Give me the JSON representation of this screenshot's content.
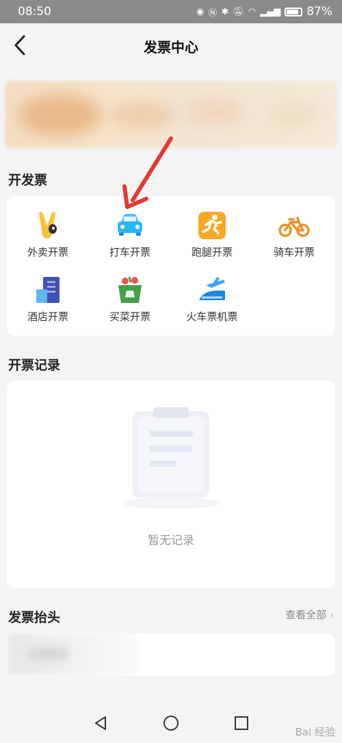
{
  "status_bar": {
    "time": "08:50",
    "battery_pct": "87%"
  },
  "header": {
    "title": "发票中心"
  },
  "invoice_section": {
    "title": "开发票",
    "services": [
      {
        "label": "外卖开票",
        "icon": "waimai-icon"
      },
      {
        "label": "打车开票",
        "icon": "taxi-icon"
      },
      {
        "label": "跑腿开票",
        "icon": "errand-icon"
      },
      {
        "label": "骑车开票",
        "icon": "bike-icon"
      },
      {
        "label": "酒店开票",
        "icon": "hotel-icon"
      },
      {
        "label": "买菜开票",
        "icon": "grocery-icon"
      },
      {
        "label": "火车票机票",
        "icon": "train-plane-icon"
      }
    ]
  },
  "records_section": {
    "title": "开票记录",
    "empty_text": "暂无记录"
  },
  "header_section": {
    "title": "发票抬头",
    "view_all": "查看全部"
  },
  "watermark": "Bai 经验",
  "colors": {
    "accent_red": "#e53935",
    "taxi_blue": "#29b6f6",
    "bike_orange": "#e8952a"
  }
}
